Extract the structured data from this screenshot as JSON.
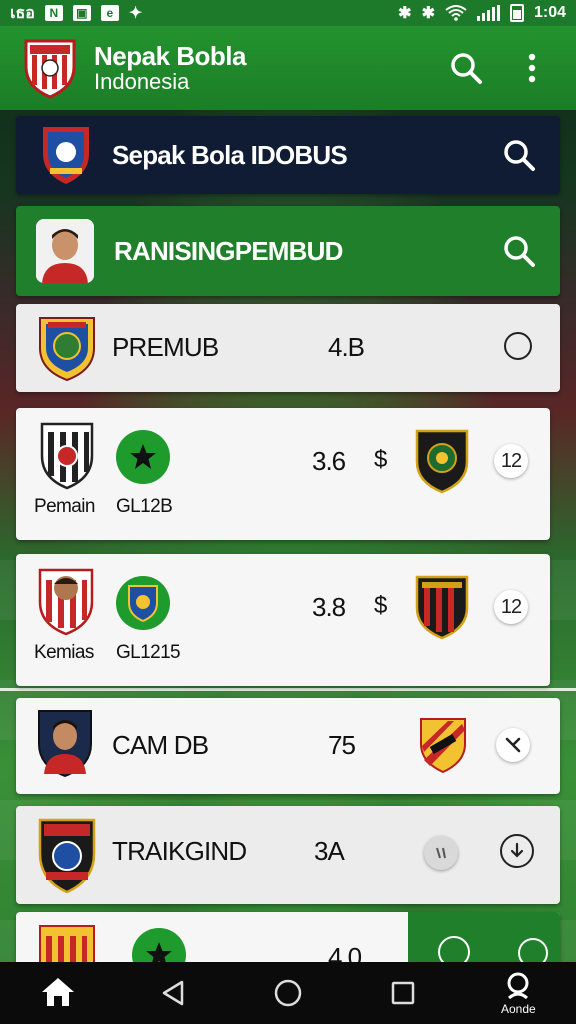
{
  "status_bar": {
    "left_text": "เธอ",
    "time": "1:04"
  },
  "app_bar": {
    "title": "Nepak Bobla",
    "subtitle": "Indonesia"
  },
  "cards": {
    "header1_title": "Sepak Bola IDOBUS",
    "header2_title": "RANISINGPEMBUD",
    "rows": [
      {
        "name": "PREMUB",
        "value": "4.B"
      },
      {
        "label_left": "Pemain",
        "label_mid": "GL12B",
        "value": "3.6",
        "currency": "$",
        "badge": "12"
      },
      {
        "label_left": "Kemias",
        "label_mid": "GL1215",
        "value": "3.8",
        "currency": "$",
        "badge": "12"
      },
      {
        "name": "CAM DB",
        "value": "75"
      },
      {
        "name": "TRAIKGIND",
        "value": "3A"
      },
      {
        "value": "4.0"
      }
    ]
  },
  "bottom_nav": {
    "home_label": "",
    "search_label": "Aonde"
  },
  "colors": {
    "primary_green": "#1f7f2a",
    "dark_navy": "#0f1c33",
    "card_white": "#f6f6f6"
  }
}
